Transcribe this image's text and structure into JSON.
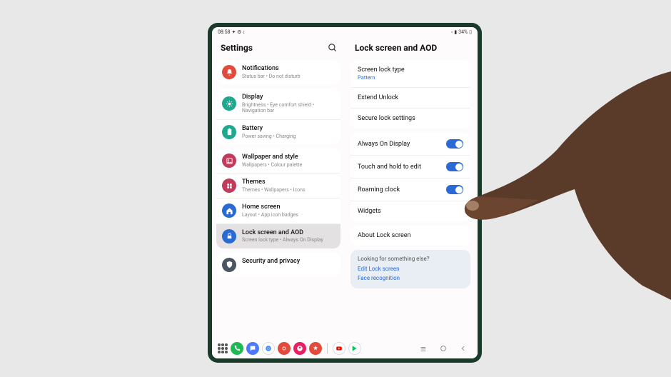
{
  "status": {
    "time": "08:58",
    "battery_text": "34%"
  },
  "left": {
    "title": "Settings",
    "items": [
      {
        "icon": "bell",
        "color": "#e24a3b",
        "title": "Notifications",
        "sub": "Status bar • Do not disturb"
      },
      {
        "icon": "sun",
        "color": "#1fa890",
        "title": "Display",
        "sub": "Brightness • Eye comfort shield • Navigation bar"
      },
      {
        "icon": "battery",
        "color": "#1fa890",
        "title": "Battery",
        "sub": "Power saving • Charging"
      },
      {
        "icon": "picture",
        "color": "#c13b5a",
        "title": "Wallpaper and style",
        "sub": "Wallpapers • Colour palette"
      },
      {
        "icon": "palette",
        "color": "#c13b5a",
        "title": "Themes",
        "sub": "Themes • Wallpapers • Icons"
      },
      {
        "icon": "home",
        "color": "#2a6ad4",
        "title": "Home screen",
        "sub": "Layout • App icon badges"
      },
      {
        "icon": "lock",
        "color": "#2a6ad4",
        "title": "Lock screen and AOD",
        "sub": "Screen lock type • Always On Display",
        "selected": true
      },
      {
        "icon": "shield",
        "color": "#4b5563",
        "title": "Security and privacy",
        "sub": ""
      }
    ]
  },
  "right": {
    "title": "Lock screen and AOD",
    "group1": {
      "lockType": {
        "title": "Screen lock type",
        "value": "Pattern"
      },
      "extend": "Extend Unlock",
      "secure": "Secure lock settings"
    },
    "group2": {
      "aod": "Always On Display",
      "touch": "Touch and hold to edit",
      "roaming": "Roaming clock",
      "widgets": "Widgets"
    },
    "group3": {
      "about": "About Lock screen"
    },
    "hint": {
      "title": "Looking for something else?",
      "link1": "Edit Lock screen",
      "link2": "Face recognition"
    }
  },
  "taskbar": {
    "apps": [
      "phone",
      "messages",
      "chrome",
      "camera",
      "gallery",
      "snow",
      "gap",
      "youtube",
      "playstore"
    ]
  }
}
